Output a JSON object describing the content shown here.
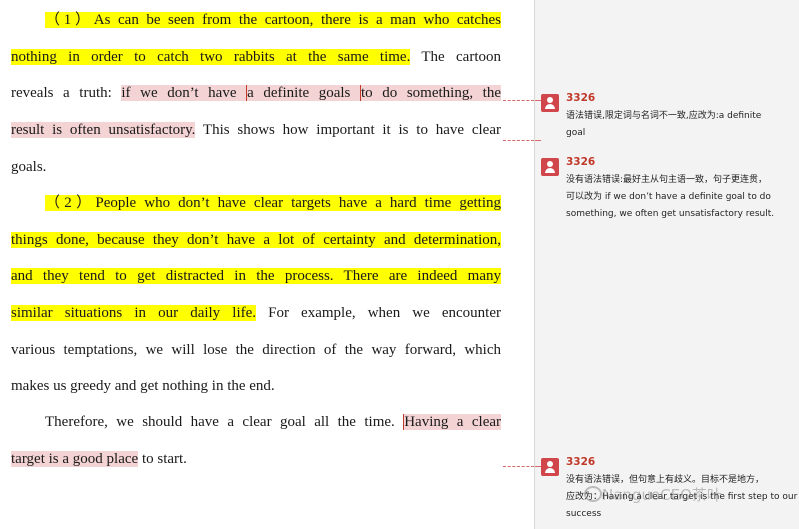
{
  "document": {
    "paragraph1": {
      "line1": "（1）As can be seen from the cartoon, there is a man who catches",
      "line2_a": "nothing in order to catch two rabbits at the same time.",
      "line2_b": " The cartoon",
      "line3_a": "reveals a truth: ",
      "line3_b": "if we don’t have ",
      "line3_c": "a definite goals ",
      "line3_d": "to do something, the",
      "line4_a": "result is often unsatisfactory.",
      "line4_b": " This shows how important it is to have clear",
      "line5": "goals."
    },
    "paragraph2": {
      "line1": "（2）People who don’t have clear targets have a hard time getting",
      "line2": "things done, because they don’t have a lot of certainty and determination,",
      "line3": "and they tend to get distracted in the process. There are indeed many",
      "line4_a": "similar situations in our daily life.",
      "line4_b": " For example, when we encounter",
      "line5": "various temptations, we will lose the direction of the way forward, which",
      "line6": "makes us greedy and get nothing in the end."
    },
    "paragraph3": {
      "line1_a": "Therefore, we should have a clear goal all the time. ",
      "line1_b": "Having a clear",
      "line2_a": "target is a good place",
      "line2_b": " to start."
    }
  },
  "comments": [
    {
      "author": "3326",
      "lines": [
        "语法错误,限定词与名词不一致,应改为:a definite",
        "goal"
      ]
    },
    {
      "author": "3326",
      "lines": [
        "没有语法错误:最好主从句主语一致，句子更连贯，",
        "可以改为 if we don’t have a definite goal to do",
        "something, we often get unsatisfactory result."
      ]
    },
    {
      "author": "3326",
      "lines": [
        "没有语法错误，但句意上有歧义。目标不是地方，",
        "应改为：Having a clear target is the first step to our",
        "success"
      ]
    }
  ],
  "watermark": "NanguoCEO茶叶",
  "colors": {
    "highlight_yellow": "#ffff00",
    "highlight_pink": "#f3d3d3",
    "comment_accent": "#c0392b"
  }
}
